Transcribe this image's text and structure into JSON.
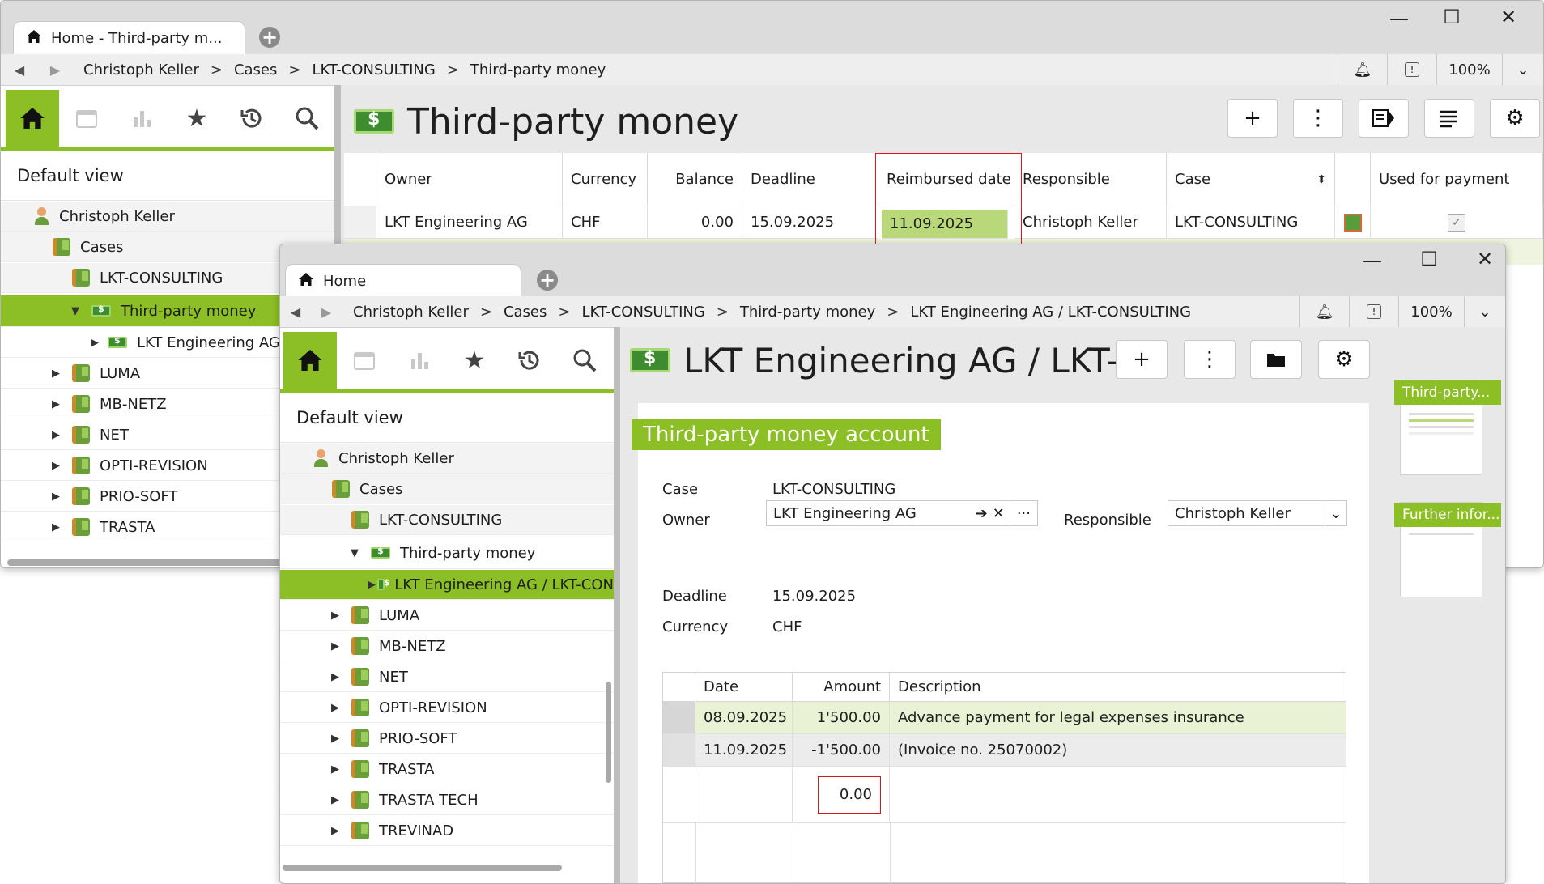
{
  "colors": {
    "accent": "#8cbf26",
    "highlight": "#d8161b"
  },
  "win1": {
    "tab_title": "Home - Third-party m...",
    "breadcrumb": [
      "Christoph Keller",
      "Cases",
      "LKT-CONSULTING",
      "Third-party money"
    ],
    "zoom": "100%",
    "default_view": "Default view",
    "tree": [
      {
        "label": "Christoph Keller",
        "icon": "person-icon"
      },
      {
        "label": "Cases",
        "icon": "folder-icon"
      },
      {
        "label": "LKT-CONSULTING",
        "icon": "folder-icon"
      },
      {
        "label": "Third-party money",
        "icon": "money-icon"
      },
      {
        "label": "LKT Engineering AG /",
        "icon": "money-icon"
      },
      {
        "label": "LUMA",
        "icon": "folder-icon"
      },
      {
        "label": "MB-NETZ",
        "icon": "folder-icon"
      },
      {
        "label": "NET",
        "icon": "folder-icon"
      },
      {
        "label": "OPTI-REVISION",
        "icon": "folder-icon"
      },
      {
        "label": "PRIO-SOFT",
        "icon": "folder-icon"
      },
      {
        "label": "TRASTA",
        "icon": "folder-icon"
      }
    ],
    "page_title": "Third-party money",
    "columns": [
      "Owner",
      "Currency",
      "Balance",
      "Deadline",
      "Reimbursed date",
      "Responsible",
      "Case",
      "",
      "Used for payment"
    ],
    "row": {
      "owner": "LKT Engineering AG",
      "currency": "CHF",
      "balance": "0.00",
      "deadline": "15.09.2025",
      "reimbursed": "11.09.2025",
      "responsible": "Christoph Keller",
      "case": "LKT-CONSULTING",
      "used_for_payment": "✓"
    }
  },
  "win2": {
    "tab_title": "Home",
    "breadcrumb": [
      "Christoph Keller",
      "Cases",
      "LKT-CONSULTING",
      "Third-party money",
      "LKT Engineering AG / LKT-CONSULTING"
    ],
    "zoom": "100%",
    "default_view": "Default view",
    "tree": [
      {
        "label": "Christoph Keller",
        "icon": "person-icon"
      },
      {
        "label": "Cases",
        "icon": "folder-icon"
      },
      {
        "label": "LKT-CONSULTING",
        "icon": "folder-icon"
      },
      {
        "label": "Third-party money",
        "icon": "money-icon"
      },
      {
        "label": "LKT Engineering AG / LKT-CON",
        "icon": "money-icon"
      },
      {
        "label": "LUMA",
        "icon": "folder-icon"
      },
      {
        "label": "MB-NETZ",
        "icon": "folder-icon"
      },
      {
        "label": "NET",
        "icon": "folder-icon"
      },
      {
        "label": "OPTI-REVISION",
        "icon": "folder-icon"
      },
      {
        "label": "PRIO-SOFT",
        "icon": "folder-icon"
      },
      {
        "label": "TRASTA",
        "icon": "folder-icon"
      },
      {
        "label": "TRASTA TECH",
        "icon": "folder-icon"
      },
      {
        "label": "TREVINAD",
        "icon": "folder-icon"
      }
    ],
    "page_title": "LKT Engineering AG / LKT-...",
    "section_title": "Third-party money  account",
    "form": {
      "case_label": "Case",
      "case_value": "LKT-CONSULTING",
      "owner_label": "Owner",
      "owner_value": "LKT Engineering AG",
      "responsible_label": "Responsible",
      "responsible_value": "Christoph Keller",
      "deadline_label": "Deadline",
      "deadline_value": "15.09.2025",
      "currency_label": "Currency",
      "currency_value": "CHF"
    },
    "table": {
      "columns": [
        "Date",
        "Amount",
        "Description"
      ],
      "rows": [
        {
          "date": "08.09.2025",
          "amount": "1'500.00",
          "description": "Advance payment for legal expenses insurance"
        },
        {
          "date": "11.09.2025",
          "amount": "-1'500.00",
          "description": "(Invoice no. 25070002)"
        }
      ],
      "total": "0.00"
    },
    "thumbs": [
      "Third-party...",
      "Further infor..."
    ]
  }
}
